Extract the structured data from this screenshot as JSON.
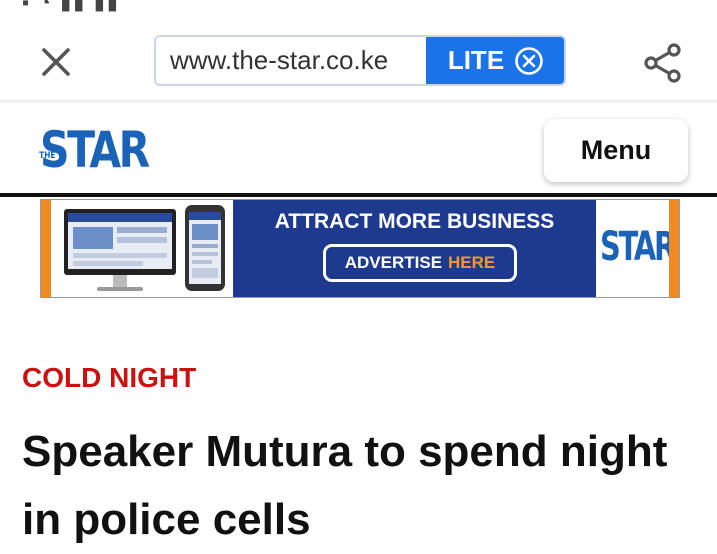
{
  "browser": {
    "url": "www.the-star.co.ke",
    "lite_label": "LITE",
    "icons": {
      "close": "close-icon",
      "lite_clear": "circle-x-icon",
      "share": "share-icon"
    },
    "accent_color": "#1a73e8"
  },
  "site": {
    "logo_text": "STAR",
    "logo_prefix": "THE",
    "menu_label": "Menu",
    "brand_color": "#1a63b8"
  },
  "ad": {
    "headline": "ATTRACT MORE BUSINESS",
    "cta_prefix": "ADVERTISE",
    "cta_highlight": "HERE",
    "logo_text": "STAR",
    "colors": {
      "background": "#1e3a8f",
      "highlight": "#f59a2a",
      "border": "#f08a24"
    }
  },
  "article": {
    "kicker": "COLD NIGHT",
    "kicker_color": "#cc1111",
    "headline": "Speaker Mutura to spend night in police cells"
  }
}
